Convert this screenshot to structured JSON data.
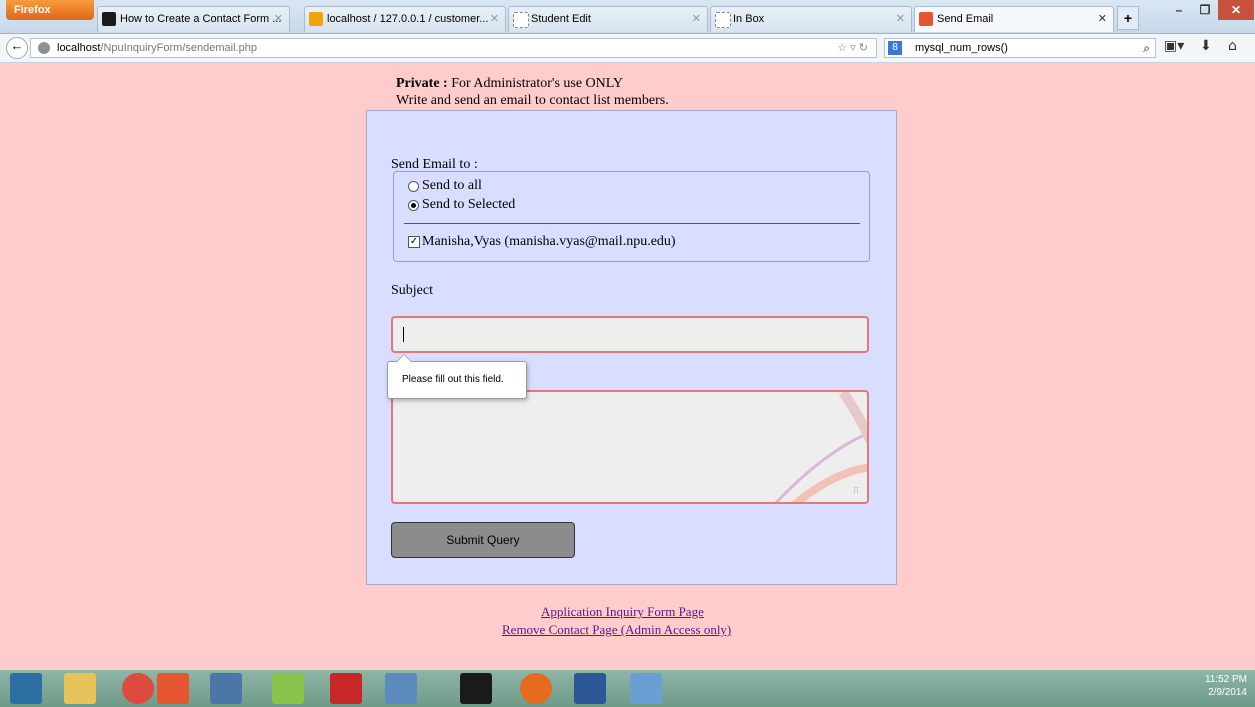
{
  "browser": {
    "app_button": "Firefox",
    "tabs": [
      {
        "label": "How to Create a Contact Form ...",
        "favicon_color": "#1b1b1b"
      },
      {
        "label": "localhost / 127.0.0.1 / customer...",
        "favicon_color": "#f1a30b"
      },
      {
        "label": "Student Edit",
        "favicon_color": "#ffffff"
      },
      {
        "label": "In Box",
        "favicon_color": "#ffffff"
      },
      {
        "label": "Send Email",
        "favicon_color": "#e4572e"
      }
    ],
    "new_tab": "+",
    "url_host": "localhost",
    "url_path": "/NpuInquiryForm/sendemail.php",
    "search_text": "mysql_num_rows()"
  },
  "page": {
    "header_strong": "Private :",
    "header_rest": " For Administrator's use ONLY",
    "header_line2": "Write and send an email to contact list members.",
    "send_to_label": "Send Email to :",
    "radio_all": "Send to all",
    "radio_selected": "Send to Selected",
    "contact_label": "Manisha,Vyas (manisha.vyas@mail.npu.edu)",
    "subject_label": "Subject",
    "tooltip": "Please fill out this field.",
    "submit_label": "Submit Query",
    "link1": "Application Inquiry Form Page",
    "link2": "Remove Contact Page (Admin Access only)"
  },
  "taskbar": {
    "time": "11:52 PM",
    "date": "2/9/2014"
  },
  "colors": {
    "page_bg": "#ffcccc",
    "card_bg": "#d9ddff",
    "invalid_border": "#e57777",
    "link": "#551a8b"
  }
}
